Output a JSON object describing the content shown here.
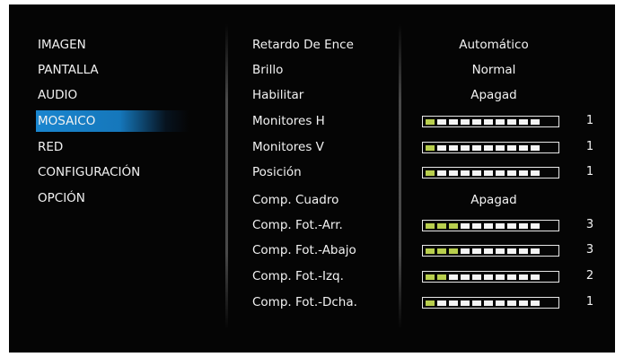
{
  "menu": [
    {
      "label": "IMAGEN",
      "active": false
    },
    {
      "label": "PANTALLA",
      "active": false
    },
    {
      "label": "AUDIO",
      "active": false
    },
    {
      "label": "MOSAICO",
      "active": true
    },
    {
      "label": "RED",
      "active": false
    },
    {
      "label": "CONFIGURACIÓN",
      "active": false
    },
    {
      "label": "OPCIÓN",
      "active": false
    }
  ],
  "settings": [
    {
      "label": "Retardo De Ence",
      "type": "text",
      "value": "Automático"
    },
    {
      "label": "Brillo",
      "type": "text",
      "value": "Normal"
    },
    {
      "label": "Habilitar",
      "type": "text",
      "value": "Apagad"
    },
    {
      "label": "Monitores H",
      "type": "slider",
      "value": "1",
      "filled": 1,
      "max": 10
    },
    {
      "label": "Monitores V",
      "type": "slider",
      "value": "1",
      "filled": 1,
      "max": 10
    },
    {
      "label": "Posición",
      "type": "slider",
      "value": "1",
      "filled": 1,
      "max": 10
    },
    {
      "label": "Comp. Cuadro",
      "type": "text",
      "value": "Apagad"
    },
    {
      "label": "Comp. Fot.-Arr.",
      "type": "slider",
      "value": "3",
      "filled": 3,
      "max": 10
    },
    {
      "label": "Comp. Fot.-Abajo",
      "type": "slider",
      "value": "3",
      "filled": 3,
      "max": 10
    },
    {
      "label": "Comp. Fot.-Izq.",
      "type": "slider",
      "value": "2",
      "filled": 2,
      "max": 10
    },
    {
      "label": "Comp. Fot.-Dcha.",
      "type": "slider",
      "value": "1",
      "filled": 1,
      "max": 10
    }
  ],
  "colors": {
    "background": "#050505",
    "highlight": "#1a86cf",
    "slider_on": "#b9cf4e",
    "slider_off": "#f4f4f4",
    "text": "#f2f2f2"
  }
}
